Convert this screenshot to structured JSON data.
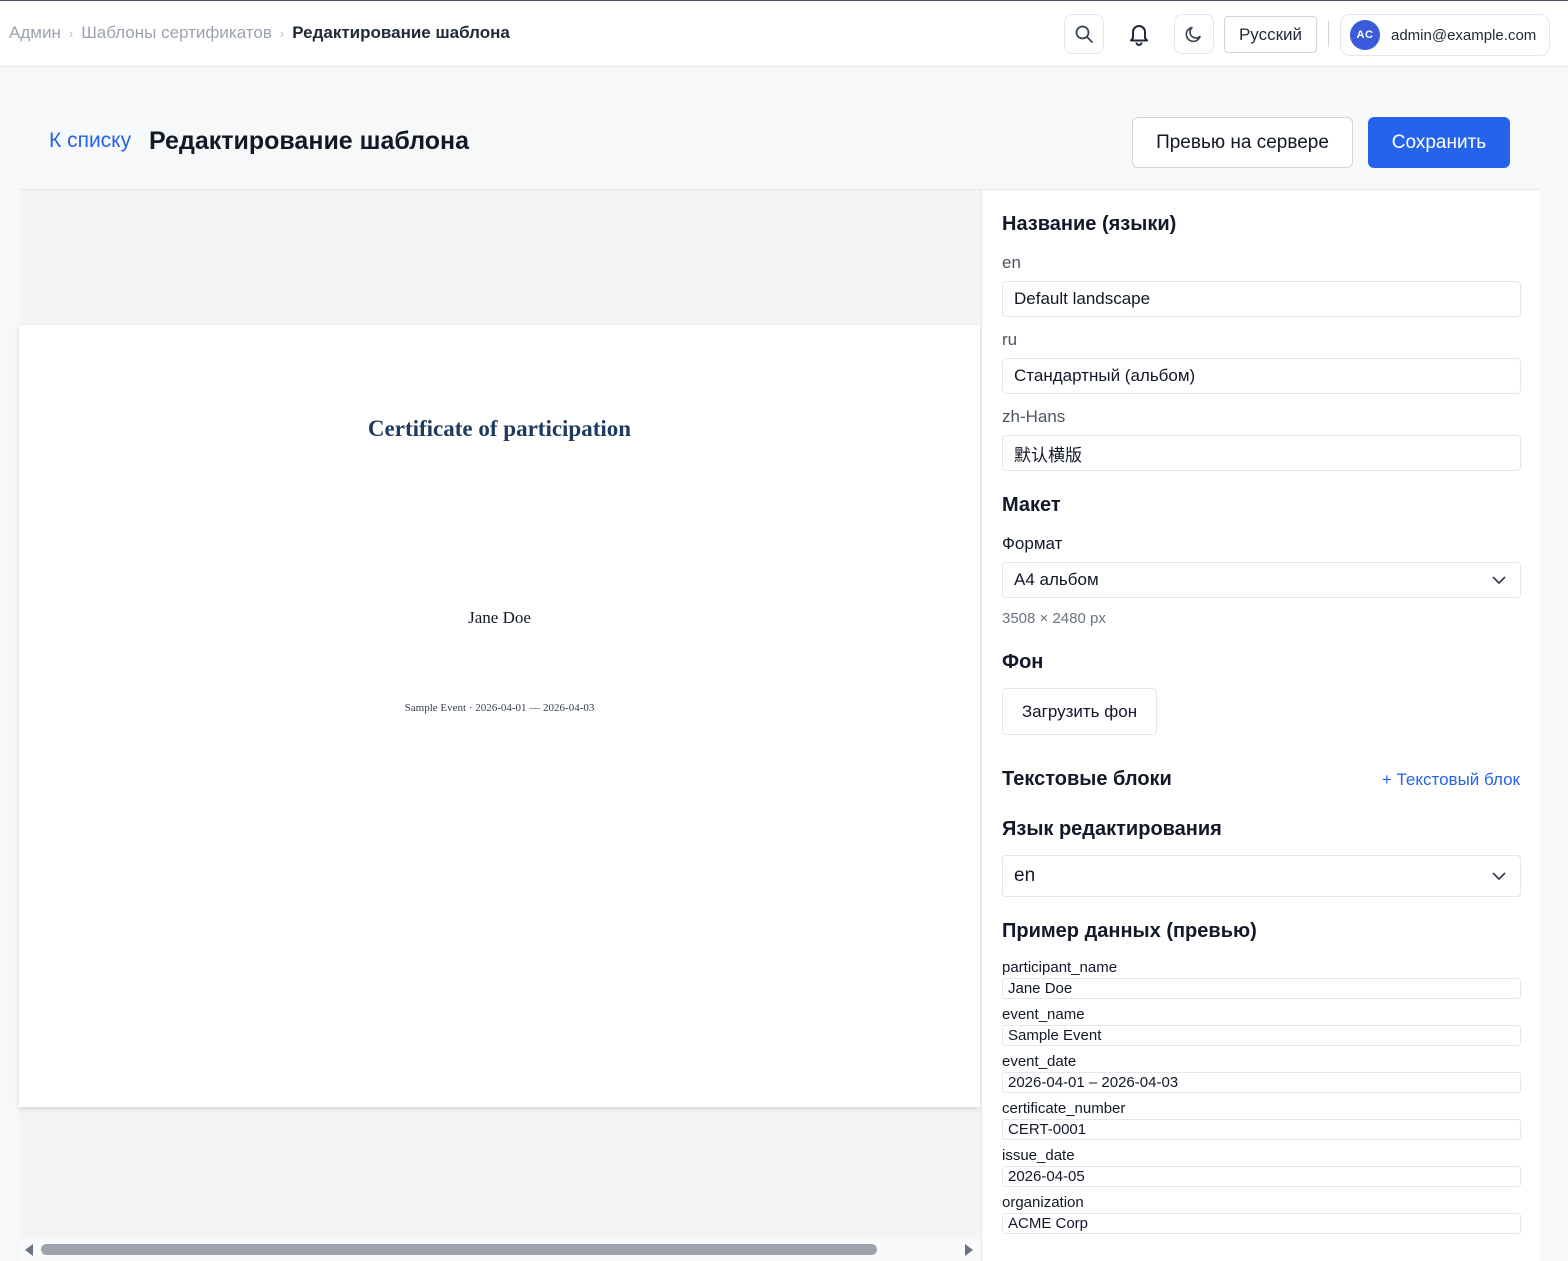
{
  "breadcrumb": {
    "items": [
      "Админ",
      "Шаблоны сертификатов"
    ],
    "current": "Редактирование шаблона"
  },
  "topbar": {
    "language": "Русский",
    "user": {
      "initials": "AC",
      "email": "admin@example.com"
    },
    "icons": [
      "search-icon",
      "bell-icon",
      "moon-icon"
    ]
  },
  "header": {
    "back_label": "К списку",
    "title": "Редактирование шаблона",
    "preview_label": "Превью на сервере",
    "save_label": "Сохранить"
  },
  "certificate": {
    "title": "Certificate of participation",
    "name": "Jane Doe",
    "event_line": "Sample Event · 2026-04-01 — 2026-04-03"
  },
  "panel": {
    "names_heading": "Название (языки)",
    "names": [
      {
        "lang": "en",
        "value": "Default landscape"
      },
      {
        "lang": "ru",
        "value": "Стандартный (альбом)"
      },
      {
        "lang": "zh-Hans",
        "value": "默认横版"
      }
    ],
    "layout_heading": "Макет",
    "format_label": "Формат",
    "format_value": "A4 альбом",
    "format_size": "3508 × 2480 px",
    "background_heading": "Фон",
    "upload_label": "Загрузить фон",
    "text_blocks_heading": "Текстовые блоки",
    "add_text_block": "+ Текстовый блок",
    "edit_lang_heading": "Язык редактирования",
    "edit_lang_value": "en",
    "sample_heading": "Пример данных (превью)",
    "sample_fields": [
      {
        "key": "participant_name",
        "value": "Jane Doe"
      },
      {
        "key": "event_name",
        "value": "Sample Event"
      },
      {
        "key": "event_date",
        "value": "2026-04-01 – 2026-04-03"
      },
      {
        "key": "certificate_number",
        "value": "CERT-0001"
      },
      {
        "key": "issue_date",
        "value": "2026-04-05"
      },
      {
        "key": "organization",
        "value": "ACME Corp"
      }
    ]
  },
  "colors": {
    "accent": "#2563eb",
    "avatar": "#3b5bdb",
    "cert_title": "#1e3a5f"
  }
}
